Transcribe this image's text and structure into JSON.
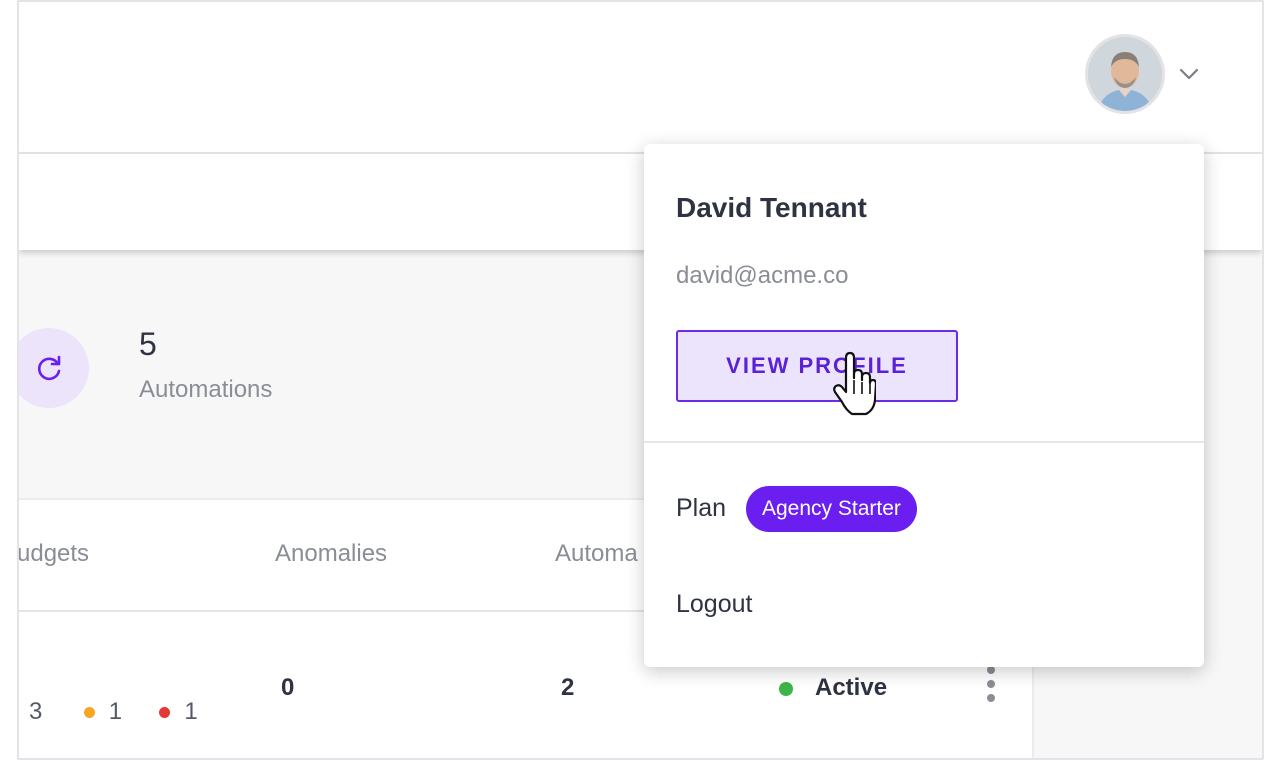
{
  "header": {
    "avatar_alt": "user avatar"
  },
  "stats": {
    "automations_count": "5",
    "automations_label": "Automations"
  },
  "table": {
    "headers": [
      "udgets",
      "Anomalies",
      "Automa"
    ],
    "row": {
      "budget_counts": [
        "3",
        "1",
        "1"
      ],
      "anomalies": "0",
      "automations": "2",
      "status": "Active"
    }
  },
  "profile_menu": {
    "name": "David Tennant",
    "email": "david@acme.co",
    "view_profile_label": "VIEW PROFILE",
    "plan_label": "Plan",
    "plan_badge": "Agency Starter",
    "logout_label": "Logout"
  },
  "colors": {
    "accent": "#6a1ff0",
    "accent_light": "#ece4fd",
    "status_green": "#3bb54a",
    "warn_orange": "#f5a623",
    "error_red": "#e53935"
  },
  "icons": [
    "chevron-down-icon",
    "refresh-icon",
    "kebab-menu-icon",
    "hand-pointer-cursor"
  ]
}
